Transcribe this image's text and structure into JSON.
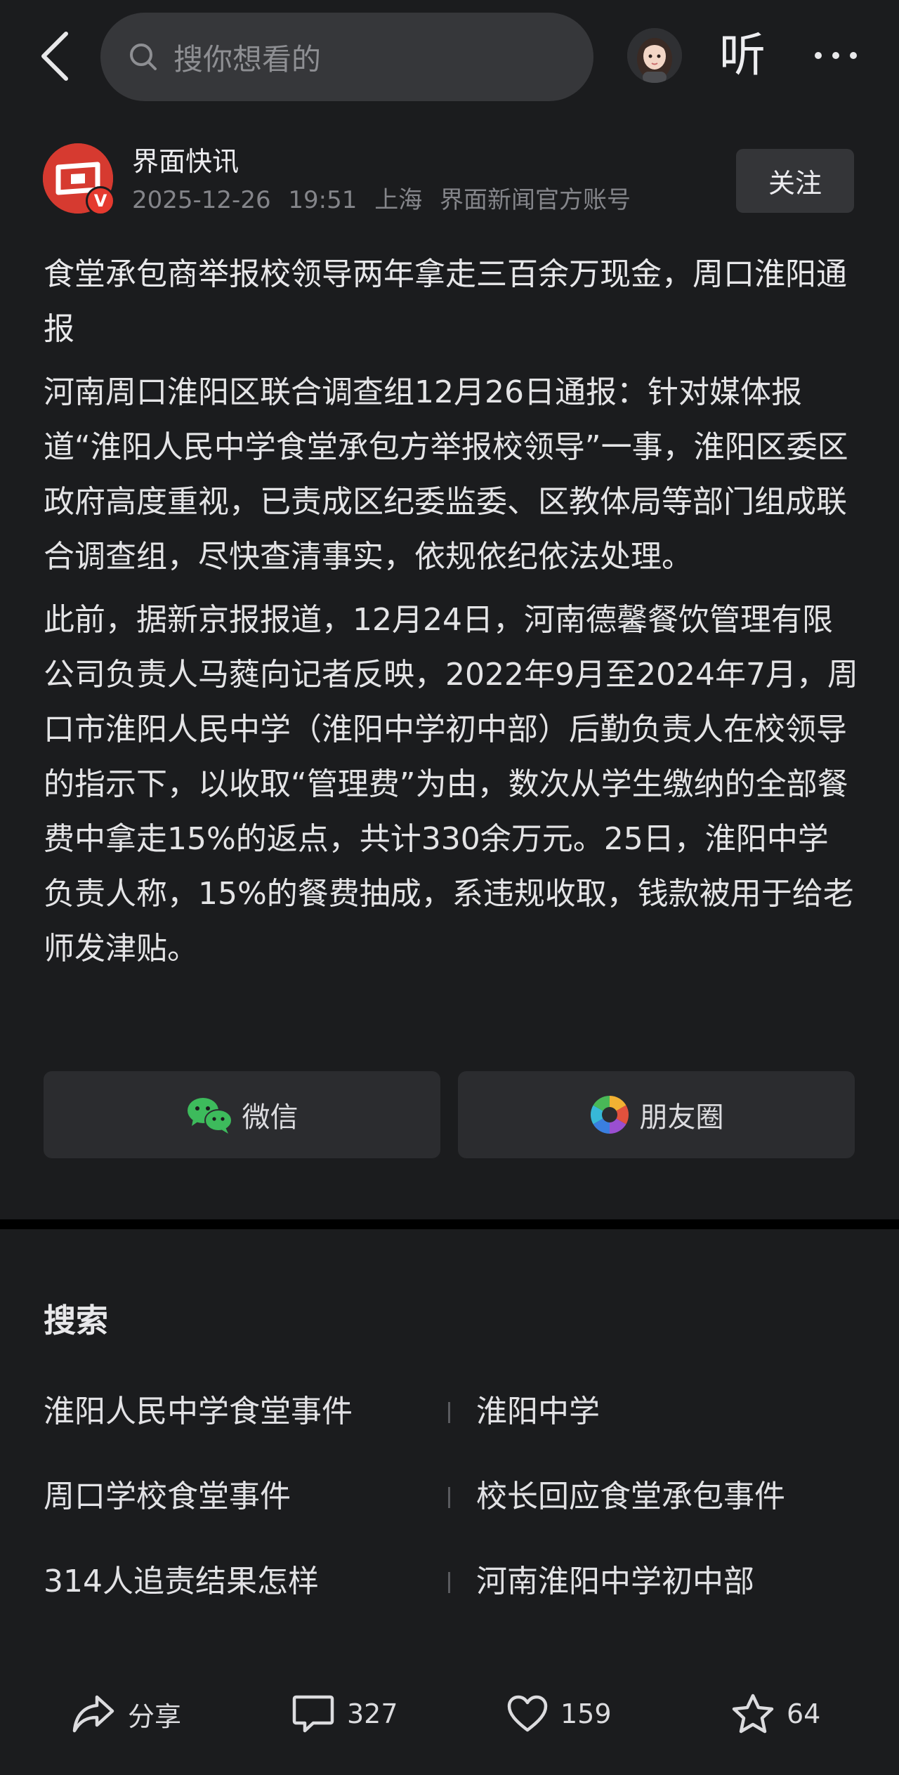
{
  "topbar": {
    "search_placeholder": "搜你想看的",
    "listen_label": "听",
    "icons": [
      "back-icon",
      "search-icon",
      "ai-avatar",
      "more-icon"
    ]
  },
  "author": {
    "name": "界面快讯",
    "date": "2025-12-26",
    "time": "19:51",
    "location": "上海",
    "account_type": "界面新闻官方账号",
    "verified_label": "V",
    "follow_label": "关注",
    "logo_color": "#d63a30"
  },
  "article": {
    "title": "食堂承包商举报校领导两年拿走三百余万现金，周口淮阳通报",
    "paragraphs": [
      "河南周口淮阳区联合调查组12月26日通报：针对媒体报道“淮阳人民中学食堂承包方举报校领导”一事，淮阳区委区政府高度重视，已责成区纪委监委、区教体局等部门组成联合调查组，尽快查清事实，依规依纪依法处理。",
      "此前，据新京报报道，12月24日，河南德馨餐饮管理有限公司负责人马蕤向记者反映，2022年9月至2024年7月，周口市淮阳人民中学（淮阳中学初中部）后勤负责人在校领导的指示下，以收取“管理费”为由，数次从学生缴纳的全部餐费中拿走15%的返点，共计330余万元。25日，淮阳中学负责人称，15%的餐费抽成，系违规收取，钱款被用于给老师发津贴。"
    ]
  },
  "share": {
    "wechat_label": "微信",
    "moments_label": "朋友圈",
    "wechat_color": "#3dbb5c"
  },
  "search_section": {
    "title": "搜索",
    "suggestions": [
      "淮阳人民中学食堂事件",
      "淮阳中学",
      "周口学校食堂事件",
      "校长回应食堂承包事件",
      "314人追责结果怎样",
      "河南淮阳中学初中部"
    ]
  },
  "bottom_bar": {
    "share_label": "分享",
    "comments": "327",
    "likes": "159",
    "favorites": "64"
  }
}
